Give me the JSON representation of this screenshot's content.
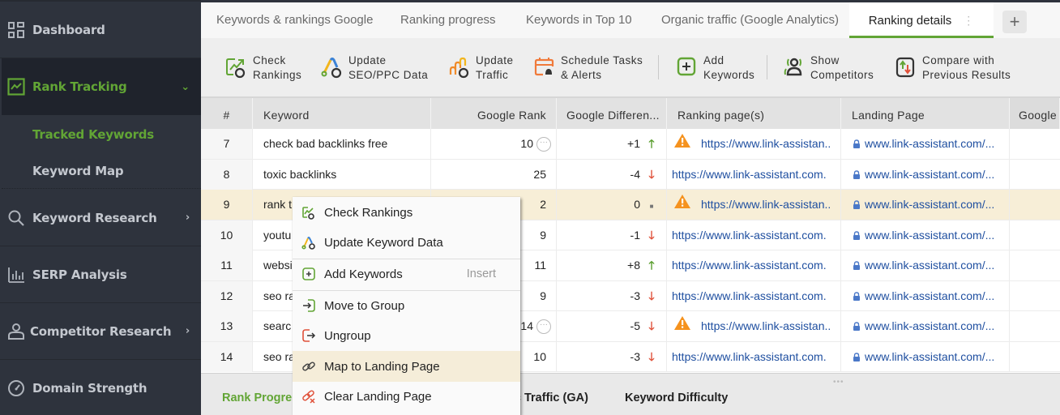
{
  "sidebar": {
    "items": [
      {
        "label": "Dashboard",
        "icon": "dashboard-grid-icon"
      },
      {
        "label": "Rank Tracking",
        "icon": "chart-line-icon",
        "expanded": true,
        "active": true
      },
      {
        "label": "Keyword Research",
        "icon": "search-icon",
        "has_children": true
      },
      {
        "label": "SERP Analysis",
        "icon": "bar-chart-icon"
      },
      {
        "label": "Competitor Research",
        "icon": "user-icon",
        "has_children": true
      },
      {
        "label": "Domain Strength",
        "icon": "gauge-icon"
      }
    ],
    "subitems": [
      {
        "label": "Tracked Keywords",
        "active": true
      },
      {
        "label": "Keyword Map"
      }
    ],
    "chevron_right": "›",
    "chevron_down": "⌄"
  },
  "tabs": [
    {
      "label": "Keywords & rankings Google"
    },
    {
      "label": "Ranking progress"
    },
    {
      "label": "Keywords in Top 10"
    },
    {
      "label": "Organic traffic (Google Analytics)"
    },
    {
      "label": "Ranking details",
      "active": true
    }
  ],
  "tab_menu_glyph": "⋮",
  "add_tab_glyph": "+",
  "toolbar": {
    "check_rankings": {
      "line1": "Check",
      "line2": "Rankings"
    },
    "update_seo": {
      "line1": "Update",
      "line2": "SEO/PPC Data"
    },
    "update_traffic": {
      "line1": "Update",
      "line2": "Traffic"
    },
    "schedule": {
      "line1": "Schedule Tasks",
      "line2": "& Alerts"
    },
    "add_keywords": {
      "line1": "Add",
      "line2": "Keywords"
    },
    "show_competitors": {
      "line1": "Show",
      "line2": "Competitors"
    },
    "compare": {
      "line1": "Compare with",
      "line2": "Previous Results"
    }
  },
  "table": {
    "columns": [
      "#",
      "Keyword",
      "Google Rank",
      "Google Differen...",
      "Ranking page(s)",
      "Landing Page",
      "Google"
    ],
    "rows": [
      {
        "num": "7",
        "keyword": "check bad backlinks free",
        "rank": "10",
        "rank_more": true,
        "diff": "+1",
        "dir": "up",
        "ranking_page": "https://www.link-assistan..",
        "warn": true,
        "landing": "www.link-assistant.com/..."
      },
      {
        "num": "8",
        "keyword": "toxic backlinks",
        "rank": "25",
        "rank_more": false,
        "diff": "-4",
        "dir": "down",
        "ranking_page": "https://www.link-assistant.com.",
        "warn": false,
        "landing": "www.link-assistant.com/..."
      },
      {
        "num": "9",
        "keyword": "rank t",
        "rank": "2",
        "rank_more": false,
        "diff": "0",
        "dir": "same",
        "ranking_page": "https://www.link-assistan..",
        "warn": true,
        "landing": "www.link-assistant.com/...",
        "selected": true
      },
      {
        "num": "10",
        "keyword": "youtu",
        "rank": "9",
        "rank_more": false,
        "diff": "-1",
        "dir": "down",
        "ranking_page": "https://www.link-assistant.com.",
        "warn": false,
        "landing": "www.link-assistant.com/..."
      },
      {
        "num": "11",
        "keyword": "websi",
        "rank": "11",
        "rank_more": false,
        "diff": "+8",
        "dir": "up",
        "ranking_page": "https://www.link-assistant.com.",
        "warn": false,
        "landing": "www.link-assistant.com/..."
      },
      {
        "num": "12",
        "keyword": "seo ra",
        "rank": "9",
        "rank_more": false,
        "diff": "-3",
        "dir": "down",
        "ranking_page": "https://www.link-assistant.com.",
        "warn": false,
        "landing": "www.link-assistant.com/..."
      },
      {
        "num": "13",
        "keyword": "searc",
        "rank": "14",
        "rank_more": true,
        "diff": "-5",
        "dir": "down",
        "ranking_page": "https://www.link-assistan..",
        "warn": true,
        "landing": "www.link-assistant.com/..."
      },
      {
        "num": "14",
        "keyword": "seo ra",
        "rank": "10",
        "rank_more": false,
        "diff": "-3",
        "dir": "down",
        "ranking_page": "https://www.link-assistant.com.",
        "warn": false,
        "landing": "www.link-assistant.com/..."
      }
    ]
  },
  "glyphs": {
    "up": "🡑",
    "down": "🡓",
    "same": "■",
    "more": "···",
    "lock": "🔒"
  },
  "bottom_tabs": [
    {
      "label": "Rank Progre",
      "active": true
    },
    {
      "label": "nic Traffic (GA)"
    },
    {
      "label": "Keyword Difficulty"
    }
  ],
  "bottom_grip": "•••",
  "context_menu": {
    "items": [
      {
        "label": "Check Rankings"
      },
      {
        "label": "Update Keyword Data"
      },
      {
        "label": "Add Keywords",
        "shortcut": "Insert"
      },
      {
        "label": "Move to Group"
      },
      {
        "label": "Ungroup"
      },
      {
        "label": "Map to Landing Page",
        "hover": true
      },
      {
        "label": "Clear Landing Page"
      }
    ]
  },
  "colors": {
    "accent_green": "#62a535",
    "sidebar_bg": "#2e333d",
    "selected_row": "#f7eed7",
    "link_blue": "#1f4fa0",
    "down_red": "#e0513a",
    "warning_orange": "#f5921e"
  }
}
